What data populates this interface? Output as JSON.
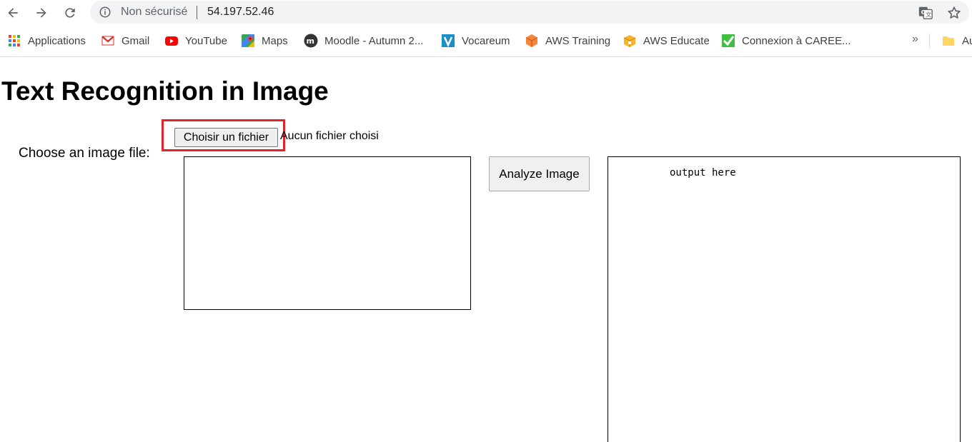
{
  "browser": {
    "security_label": "Non sécurisé",
    "url": "54.197.52.46"
  },
  "bookmarks": [
    {
      "label": "Applications",
      "icon": "apps-grid-icon"
    },
    {
      "label": "Gmail",
      "icon": "gmail-icon"
    },
    {
      "label": "YouTube",
      "icon": "youtube-icon"
    },
    {
      "label": "Maps",
      "icon": "maps-icon"
    },
    {
      "label": "Moodle - Autumn 2...",
      "icon": "moodle-icon"
    },
    {
      "label": "Vocareum",
      "icon": "vocareum-icon"
    },
    {
      "label": "AWS Training",
      "icon": "aws-training-icon"
    },
    {
      "label": "AWS Educate",
      "icon": "aws-educate-icon"
    },
    {
      "label": "Connexion à CAREE...",
      "icon": "connexion-icon"
    }
  ],
  "bookmarks_more": "»",
  "bookmarks_folder_label": "Au",
  "page": {
    "title": "Text Recognition in Image",
    "choose_label": "Choose an image file:",
    "file_button": "Choisir un fichier",
    "file_status": "Aucun fichier choisi",
    "analyze_button": "Analyze Image",
    "output_text": "output here"
  },
  "colors": {
    "highlight": "#e0242a",
    "omnibox_bg": "#f1f3f4"
  }
}
